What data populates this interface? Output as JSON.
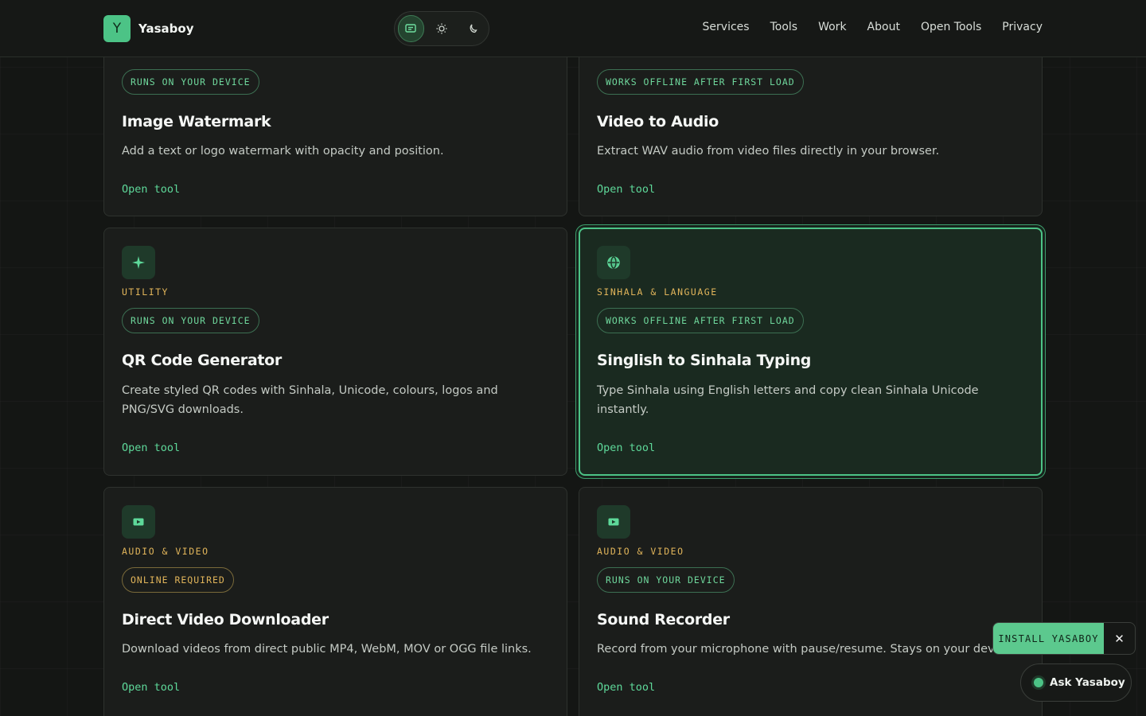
{
  "brand": {
    "logo_letter": "Y",
    "name": "Yasaboy"
  },
  "theme_switch": {
    "options": [
      "system-icon",
      "sun-icon",
      "moon-icon"
    ],
    "active": "system"
  },
  "nav": [
    "Services",
    "Tools",
    "Work",
    "About",
    "Open Tools",
    "Privacy"
  ],
  "cards": [
    {
      "badge": "RUNS ON YOUR DEVICE",
      "title": "Image Watermark",
      "desc": "Add a text or logo watermark with opacity and position.",
      "link": "Open tool"
    },
    {
      "badge": "WORKS OFFLINE AFTER FIRST LOAD",
      "title": "Video to Audio",
      "desc": "Extract WAV audio from video files directly in your browser.",
      "link": "Open tool"
    },
    {
      "icon": "sparkle-icon",
      "category": "UTILITY",
      "badge": "RUNS ON YOUR DEVICE",
      "title": "QR Code Generator",
      "desc": "Create styled QR codes with Sinhala, Unicode, colours, logos and PNG/SVG downloads.",
      "link": "Open tool"
    },
    {
      "icon": "globe-icon",
      "category": "SINHALA & LANGUAGE",
      "badge": "WORKS OFFLINE AFTER FIRST LOAD",
      "title": "Singlish to Sinhala Typing",
      "desc": "Type Sinhala using English letters and copy clean Sinhala Unicode instantly.",
      "link": "Open tool"
    },
    {
      "icon": "video-icon",
      "category": "AUDIO & VIDEO",
      "badge": "ONLINE REQUIRED",
      "title": "Direct Video Downloader",
      "desc": "Download videos from direct public MP4, WebM, MOV or OGG file links.",
      "link": "Open tool"
    },
    {
      "icon": "video-icon",
      "category": "AUDIO & VIDEO",
      "badge": "RUNS ON YOUR DEVICE",
      "title": "Sound Recorder",
      "desc": "Record from your microphone with pause/resume. Stays on your device.",
      "link": "Open tool"
    }
  ],
  "install": {
    "label": "INSTALL YASABOY",
    "close": "✕"
  },
  "ask": {
    "label": "Ask Yasaboy"
  },
  "colors": {
    "accent": "#4cc386",
    "category": "#e0b45a",
    "background": "#141614"
  }
}
